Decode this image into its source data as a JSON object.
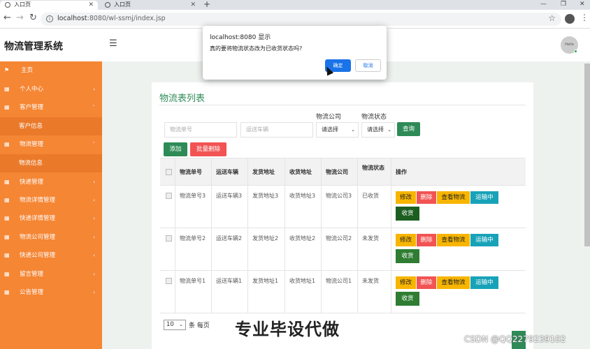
{
  "browser": {
    "tabs": [
      {
        "title": "入口页",
        "active": true
      },
      {
        "title": "入口页",
        "active": false
      }
    ],
    "new_tab": "+",
    "url_host": "localhost",
    "url_rest": ":8080/wl-ssmj/index.jsp",
    "win_min": "—",
    "win_max": "❐",
    "win_close": "✕"
  },
  "app": {
    "title": "物流管理系统",
    "avatar_text": "Hello"
  },
  "sidebar": {
    "items": [
      {
        "label": "主页",
        "icon": "flag-icon",
        "glyph": "⚑",
        "chevron": ""
      },
      {
        "label": "个人中心",
        "icon": "grid-icon",
        "glyph": "▦",
        "chevron": "‹"
      },
      {
        "label": "客户管理",
        "icon": "grid-icon",
        "glyph": "▦",
        "chevron": "ˇ"
      },
      {
        "label": "客户信息",
        "sub": true
      },
      {
        "label": "物流管理",
        "icon": "grid-icon",
        "glyph": "▦",
        "chevron": "ˇ"
      },
      {
        "label": "物流信息",
        "sub": true
      },
      {
        "label": "快递管理",
        "icon": "grid-icon",
        "glyph": "▦",
        "chevron": "‹"
      },
      {
        "label": "物流详情管理",
        "icon": "grid-icon",
        "glyph": "▦",
        "chevron": "‹"
      },
      {
        "label": "快递详情管理",
        "icon": "grid-icon",
        "glyph": "▦",
        "chevron": "‹"
      },
      {
        "label": "物流公司管理",
        "icon": "grid-icon",
        "glyph": "▦",
        "chevron": "‹"
      },
      {
        "label": "快递公司管理",
        "icon": "grid-icon",
        "glyph": "▦",
        "chevron": "‹"
      },
      {
        "label": "留言管理",
        "icon": "grid-icon",
        "glyph": "▦",
        "chevron": "‹"
      },
      {
        "label": "公告管理",
        "icon": "grid-icon",
        "glyph": "▦",
        "chevron": "‹"
      }
    ]
  },
  "main": {
    "card_title": "物流表列表",
    "search": {
      "order_placeholder": "物流单号",
      "vehicle_placeholder": "运送车辆",
      "company_label": "物流公司",
      "company_value": "请选择",
      "status_label": "物流状态",
      "status_value": "请选择",
      "query_button": "查询"
    },
    "add_button": "添加",
    "batch_delete_button": "批量删除",
    "table": {
      "headers": [
        "物流单号",
        "运送车辆",
        "发货地址",
        "收货地址",
        "物流公司",
        "物流状态",
        "操作"
      ],
      "rows": [
        {
          "order": "物流单号3",
          "vehicle": "运送车辆3",
          "from": "发货地址3",
          "to": "收货地址3",
          "company": "物流公司3",
          "status": "已收货"
        },
        {
          "order": "物流单号2",
          "vehicle": "运送车辆2",
          "from": "发货地址2",
          "to": "收货地址2",
          "company": "物流公司2",
          "status": "未发货"
        },
        {
          "order": "物流单号1",
          "vehicle": "运送车辆1",
          "from": "发货地址1",
          "to": "收货地址1",
          "company": "物流公司1",
          "status": "未发货"
        }
      ],
      "actions": {
        "edit": "修改",
        "delete": "删除",
        "view": "查看物流",
        "shipping": "运输中",
        "receive": "收货"
      }
    },
    "pager": {
      "size": "10",
      "suffix": "条 每页"
    }
  },
  "dialog": {
    "title": "localhost:8080 显示",
    "message": "真的要将物流状态改为已收货状态吗?",
    "ok": "确定",
    "cancel": "取消"
  },
  "overlay": {
    "watermark": "专业毕设代做",
    "csdn": "CSDN @QQ2279239102"
  },
  "colors": {
    "sidebar": "#f58634",
    "accent_green": "#2e8b57",
    "danger": "#f25353",
    "warning": "#f7b500",
    "info": "#17a2b8"
  }
}
